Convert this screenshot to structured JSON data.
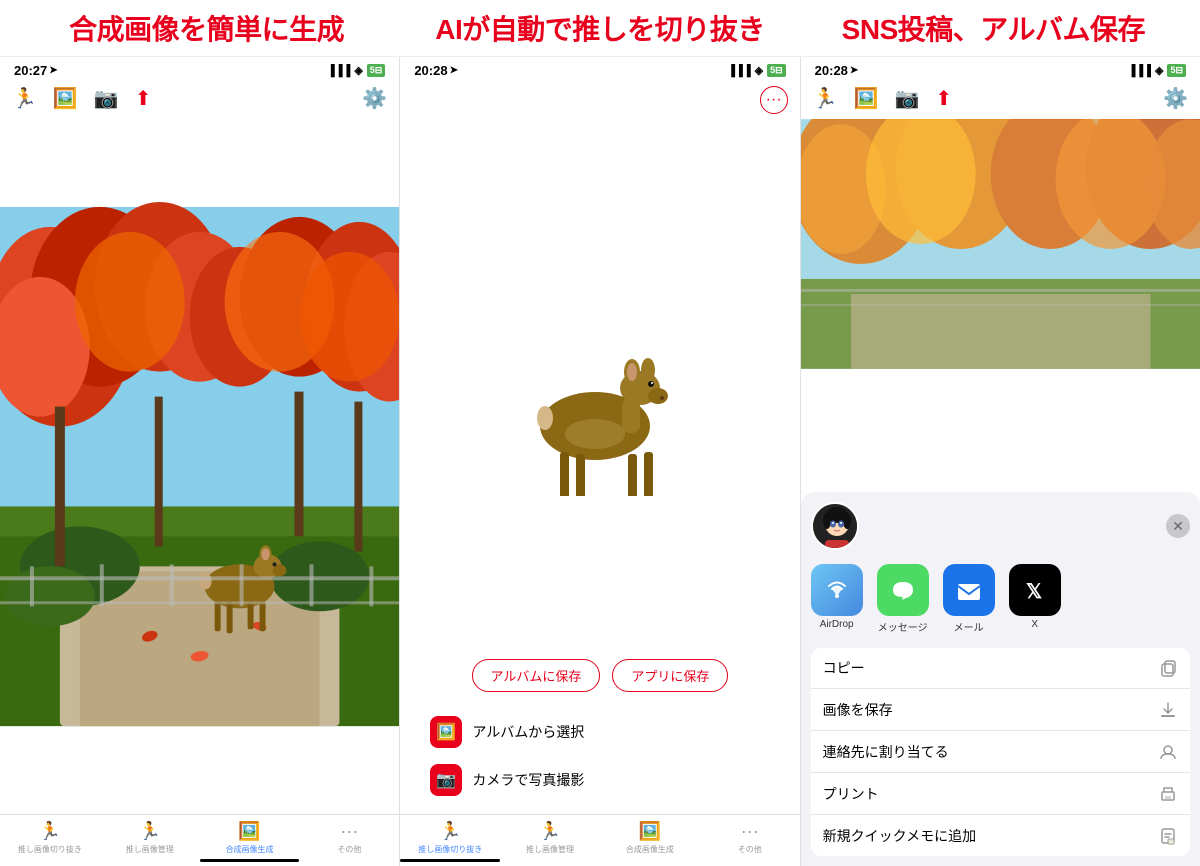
{
  "header": {
    "title1": "合成画像を簡単に生成",
    "title2": "AIが自動で推しを切り抜き",
    "title3": "SNS投稿、アルバム保存"
  },
  "phone1": {
    "time": "20:27",
    "status": "..il 令 5⊟",
    "toolbar_icons": [
      "run",
      "photo",
      "camera",
      "share",
      "gear"
    ],
    "tab_items": [
      {
        "label": "推し画像切り抜き",
        "icon": "🏃",
        "active": false
      },
      {
        "label": "推し画像管理",
        "icon": "🏃",
        "active": false
      },
      {
        "label": "合成画像生成",
        "icon": "🖼",
        "active": true
      },
      {
        "label": "その他",
        "icon": "···",
        "active": false
      }
    ]
  },
  "phone2": {
    "time": "20:28",
    "status": "..il 令 5⊟",
    "btn_save_album": "アルバムに保存",
    "btn_save_app": "アプリに保存",
    "menu_album": "アルバムから選択",
    "menu_camera": "カメラで写真撮影",
    "tab_items": [
      {
        "label": "推し画像切り抜き",
        "icon": "🏃",
        "active": true
      },
      {
        "label": "推し画像管理",
        "icon": "🏃",
        "active": false
      },
      {
        "label": "合成画像生成",
        "icon": "🖼",
        "active": false
      },
      {
        "label": "その他",
        "icon": "···",
        "active": false
      }
    ]
  },
  "phone3": {
    "time": "20:28",
    "status": "..il 令 5⊟",
    "share_items": [
      {
        "name": "AirDrop",
        "color": "#007AFF"
      },
      {
        "name": "メッセージ",
        "color": "#4CD964"
      },
      {
        "name": "メール",
        "color": "#007AFF"
      },
      {
        "name": "X",
        "color": "#000000"
      }
    ],
    "menu_items": [
      {
        "label": "コピー",
        "icon": "copy"
      },
      {
        "label": "画像を保存",
        "icon": "save"
      },
      {
        "label": "連絡先に割り当てる",
        "icon": "contact"
      },
      {
        "label": "プリント",
        "icon": "print"
      },
      {
        "label": "新規クイックメモに追加",
        "icon": "memo"
      }
    ]
  }
}
